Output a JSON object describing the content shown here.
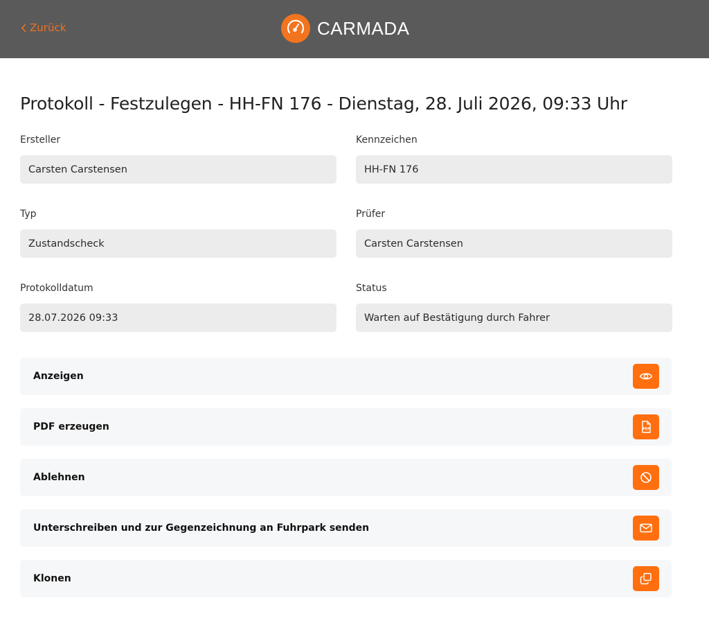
{
  "header": {
    "back_label": "Zurück",
    "brand_name": "CARMADA",
    "background": "#5a5a5a",
    "accent": "#f07320"
  },
  "page": {
    "title": "Protokoll - Festzulegen - HH-FN 176 - Dienstag, 28. Juli 2026, 09:33 Uhr"
  },
  "fields": {
    "ersteller": {
      "label": "Ersteller",
      "value": "Carsten Carstensen"
    },
    "kennzeichen": {
      "label": "Kennzeichen",
      "value": "HH-FN 176"
    },
    "typ": {
      "label": "Typ",
      "value": "Zustandscheck"
    },
    "pruefer": {
      "label": "Prüfer",
      "value": "Carsten Carstensen"
    },
    "protokolldatum": {
      "label": "Protokolldatum",
      "value": "28.07.2026 09:33"
    },
    "status": {
      "label": "Status",
      "value": "Warten auf Bestätigung durch Fahrer"
    }
  },
  "actions": [
    {
      "label": "Anzeigen",
      "icon": "eye-icon"
    },
    {
      "label": "PDF erzeugen",
      "icon": "pdf-file-icon"
    },
    {
      "label": "Ablehnen",
      "icon": "ban-icon"
    },
    {
      "label": "Unterschreiben und zur Gegenzeichnung an Fuhrpark senden",
      "icon": "envelope-icon"
    },
    {
      "label": "Klonen",
      "icon": "copy-icon"
    }
  ],
  "colors": {
    "button": "#ff6f0f",
    "field_bg": "#ececec",
    "row_bg": "#f6f7f8"
  }
}
